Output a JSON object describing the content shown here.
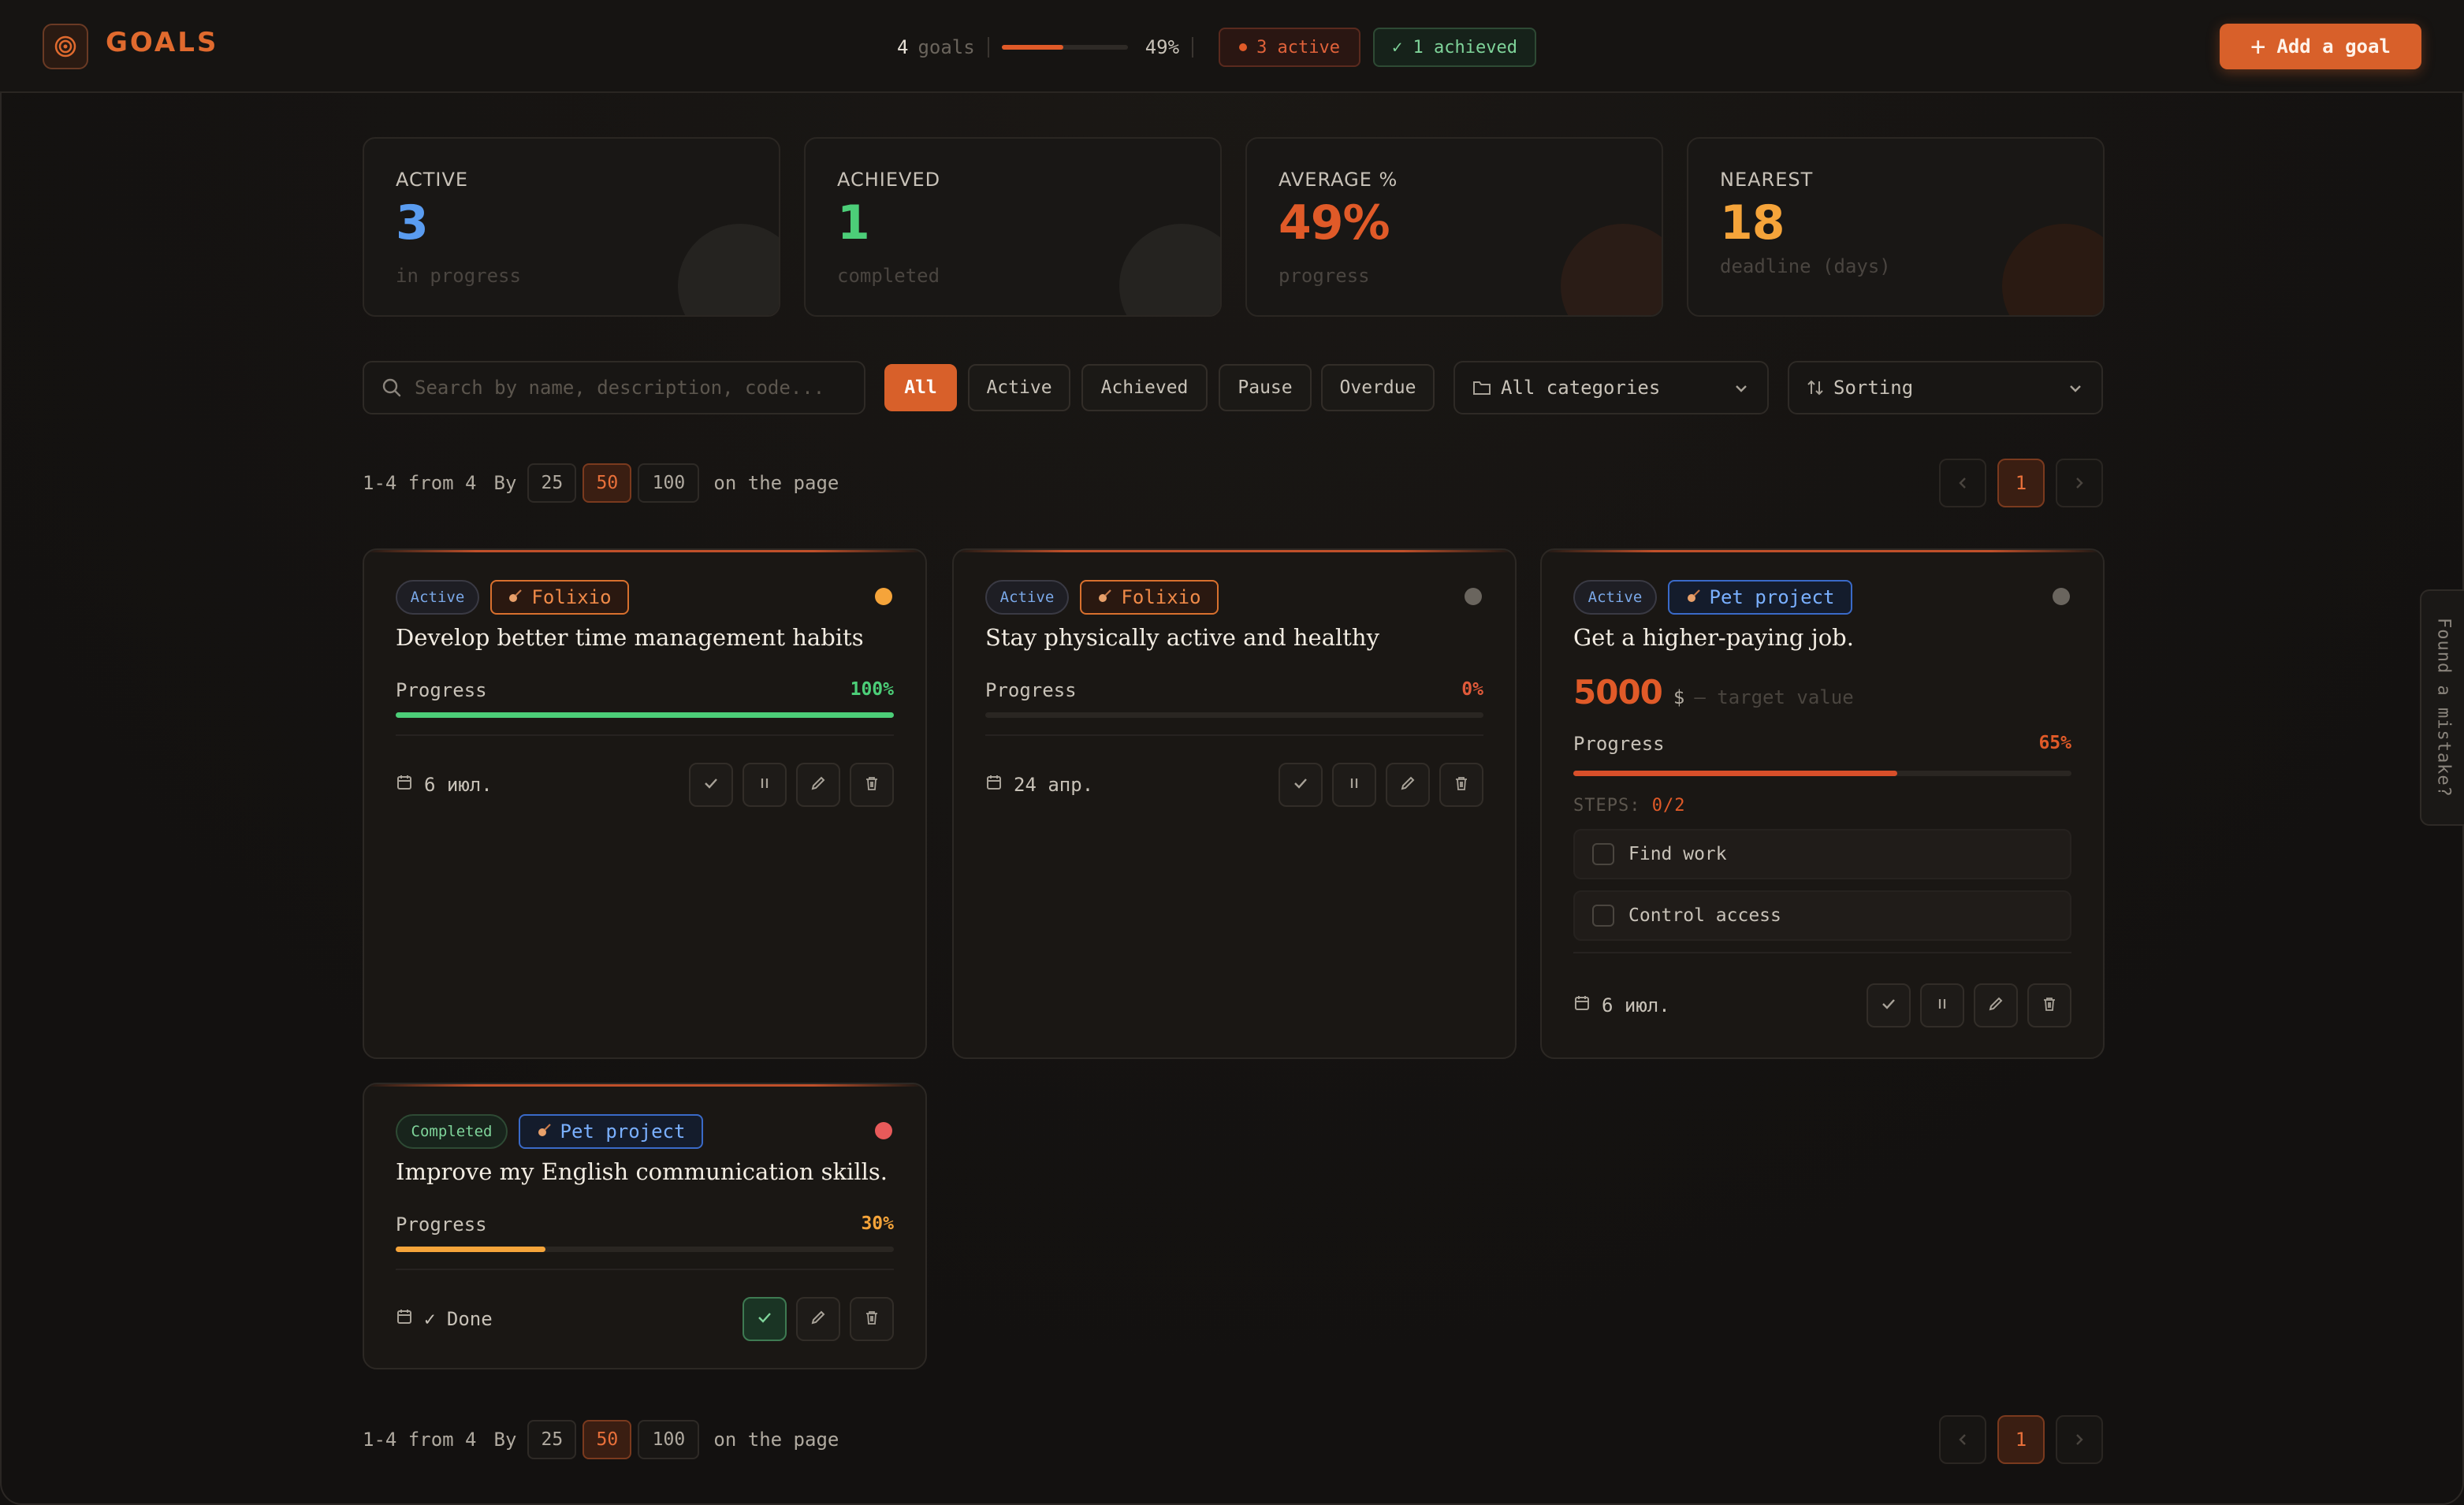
{
  "header": {
    "logo_label": "GOALS",
    "goals_count": "4",
    "goals_label": "goals",
    "progress_fraction": 0.49,
    "progress_pct": "49%",
    "active_pill": "3 active",
    "achieved_pill": "✓ 1 achieved",
    "add_button": "Add a goal"
  },
  "stats": [
    {
      "title": "ACTIVE",
      "value": "3",
      "sub": "in progress",
      "color": "#5a9cf0"
    },
    {
      "title": "ACHIEVED",
      "value": "1",
      "sub": "completed",
      "color": "#4cce78"
    },
    {
      "title": "AVERAGE %",
      "value": "49%",
      "sub": "progress",
      "color": "#e05a28"
    },
    {
      "title": "NEAREST",
      "value": "18",
      "sub": "deadline (days)",
      "color": "#f5a43a"
    }
  ],
  "filters": {
    "search_placeholder": "Search by name, description, code...",
    "chips": [
      "All",
      "Active",
      "Achieved",
      "Pause",
      "Overdue"
    ],
    "category_select": "All categories",
    "sort_select": "Sorting"
  },
  "pagination": {
    "range": "1-4 from 4",
    "by": "By",
    "sizes": [
      "25",
      "50",
      "100"
    ],
    "suffix": "on the page",
    "current_page": "1"
  },
  "goals": [
    {
      "status": "Active",
      "category": "Folixio",
      "title": "Develop better time management habits",
      "progress_label": "Progress",
      "progress": "100%",
      "progress_value": 100,
      "due": "6 июл."
    },
    {
      "status": "Active",
      "category": "Folixio",
      "title": "Stay physically active and healthy",
      "progress_label": "Progress",
      "progress": "0%",
      "progress_value": 0,
      "due": "24 апр."
    },
    {
      "status": "Active",
      "category": "Pet project",
      "title": "Get a higher-paying job.",
      "target_value": "5000",
      "target_unit": "$",
      "target_hint": "— target value",
      "progress_label": "Progress",
      "progress": "65%",
      "progress_value": 65,
      "steps_label": "STEPS:",
      "steps_count": "0/2",
      "steps": [
        "Find work",
        "Control access"
      ],
      "due": "6 июл."
    },
    {
      "status": "Completed",
      "category": "Pet project",
      "title": "Improve my English communication skills.",
      "progress_label": "Progress",
      "progress": "30%",
      "progress_value": 30,
      "due": "✓ Done"
    }
  ],
  "side_tab": "Found a mistake?"
}
